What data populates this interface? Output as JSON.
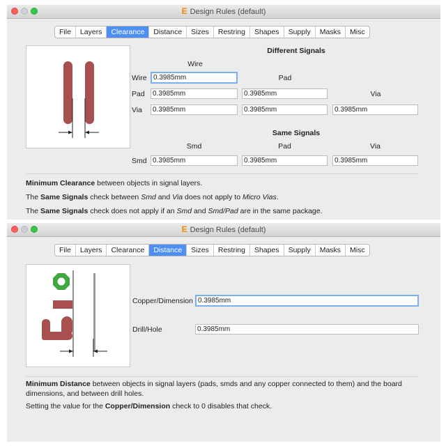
{
  "window_title": "Design Rules (default)",
  "tabs": [
    "File",
    "Layers",
    "Clearance",
    "Distance",
    "Sizes",
    "Restring",
    "Shapes",
    "Supply",
    "Masks",
    "Misc"
  ],
  "clearance": {
    "active_tab": "Clearance",
    "different_heading": "Different Signals",
    "same_heading": "Same Signals",
    "col_wire": "Wire",
    "col_pad": "Pad",
    "col_via": "Via",
    "col_smd": "Smd",
    "row_wire": "Wire",
    "row_pad": "Pad",
    "row_via": "Via",
    "row_smd": "Smd",
    "wire_wire": "0.3985mm",
    "pad_wire": "0.3985mm",
    "pad_pad": "0.3985mm",
    "via_wire": "0.3985mm",
    "via_pad": "0.3985mm",
    "via_via": "0.3985mm",
    "smd_smd": "0.3985mm",
    "smd_pad": "0.3985mm",
    "smd_via": "0.3985mm",
    "desc1_bold": "Minimum Clearance",
    "desc1_rest": " between objects in signal layers.",
    "desc2_a": "The ",
    "desc2_b": "Same Signals",
    "desc2_c": " check between ",
    "desc2_d": "Smd",
    "desc2_e": " and ",
    "desc2_f": "Via",
    "desc2_g": " does not apply to ",
    "desc2_h": "Micro Vias",
    "desc2_i": ".",
    "desc3_a": "The ",
    "desc3_b": "Same Signals",
    "desc3_c": " check does not apply if an ",
    "desc3_d": "Smd",
    "desc3_e": " and ",
    "desc3_f": "Smd/Pad",
    "desc3_g": " are in the same package."
  },
  "distance": {
    "active_tab": "Distance",
    "copper_label": "Copper/Dimension",
    "copper_value": "0.3985mm",
    "drill_label": "Drill/Hole",
    "drill_value": "0.3985mm",
    "desc1_bold": "Minimum Distance",
    "desc1_rest": " between objects in signal layers (pads, smds and any copper connected to them) and the board dimensions, and between drill holes.",
    "desc2_a": "Setting the value for the ",
    "desc2_b": "Copper/Dimension",
    "desc2_c": " check to 0 disables that check."
  },
  "colors": {
    "trace": "#a84f4f",
    "pad_green": "#3ea83e",
    "tab_active": "#4d8ff5",
    "focus": "#7aaef2"
  }
}
